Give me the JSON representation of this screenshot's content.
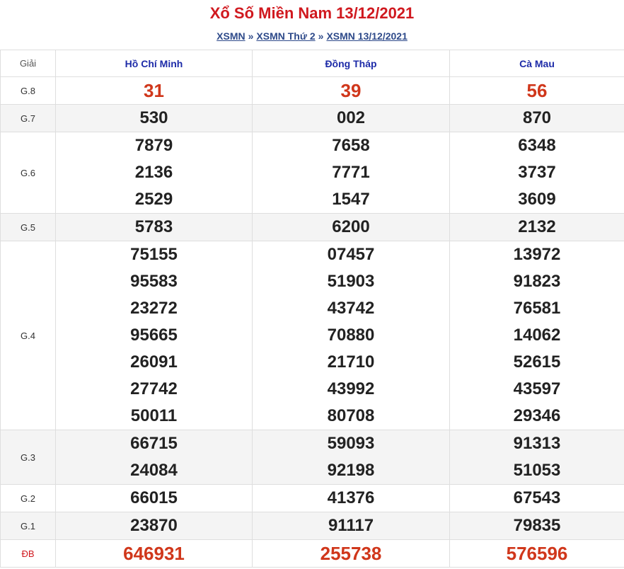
{
  "header": {
    "title": "Xổ Số Miền Nam 13/12/2021",
    "breadcrumb": [
      {
        "label": "XSMN"
      },
      {
        "label": "XSMN Thứ 2"
      },
      {
        "label": "XSMN 13/12/2021"
      }
    ],
    "separator": "»"
  },
  "table": {
    "col_header_label": "Giải",
    "provinces": [
      "Hồ Chí Minh",
      "Đồng Tháp",
      "Cà Mau"
    ],
    "rows": [
      {
        "label": "G.8",
        "alt": false,
        "red": true,
        "values": [
          [
            "31"
          ],
          [
            "39"
          ],
          [
            "56"
          ]
        ]
      },
      {
        "label": "G.7",
        "alt": true,
        "red": false,
        "values": [
          [
            "530"
          ],
          [
            "002"
          ],
          [
            "870"
          ]
        ]
      },
      {
        "label": "G.6",
        "alt": false,
        "red": false,
        "values": [
          [
            "7879",
            "2136",
            "2529"
          ],
          [
            "7658",
            "7771",
            "1547"
          ],
          [
            "6348",
            "3737",
            "3609"
          ]
        ]
      },
      {
        "label": "G.5",
        "alt": true,
        "red": false,
        "values": [
          [
            "5783"
          ],
          [
            "6200"
          ],
          [
            "2132"
          ]
        ]
      },
      {
        "label": "G.4",
        "alt": false,
        "red": false,
        "values": [
          [
            "75155",
            "95583",
            "23272",
            "95665",
            "26091",
            "27742",
            "50011"
          ],
          [
            "07457",
            "51903",
            "43742",
            "70880",
            "21710",
            "43992",
            "80708"
          ],
          [
            "13972",
            "91823",
            "76581",
            "14062",
            "52615",
            "43597",
            "29346"
          ]
        ]
      },
      {
        "label": "G.3",
        "alt": true,
        "red": false,
        "values": [
          [
            "66715",
            "24084"
          ],
          [
            "59093",
            "92198"
          ],
          [
            "91313",
            "51053"
          ]
        ]
      },
      {
        "label": "G.2",
        "alt": false,
        "red": false,
        "values": [
          [
            "66015"
          ],
          [
            "41376"
          ],
          [
            "67543"
          ]
        ]
      },
      {
        "label": "G.1",
        "alt": true,
        "red": false,
        "values": [
          [
            "23870"
          ],
          [
            "91117"
          ],
          [
            "79835"
          ]
        ]
      },
      {
        "label": "ĐB",
        "alt": false,
        "red": true,
        "db": true,
        "values": [
          [
            "646931"
          ],
          [
            "255738"
          ],
          [
            "576596"
          ]
        ]
      }
    ]
  },
  "colors": {
    "title": "#d0191f",
    "link": "#2e4a8a",
    "province": "#1d2ba8",
    "highlight_number": "#d0371b",
    "alt_row": "#f4f4f4"
  }
}
